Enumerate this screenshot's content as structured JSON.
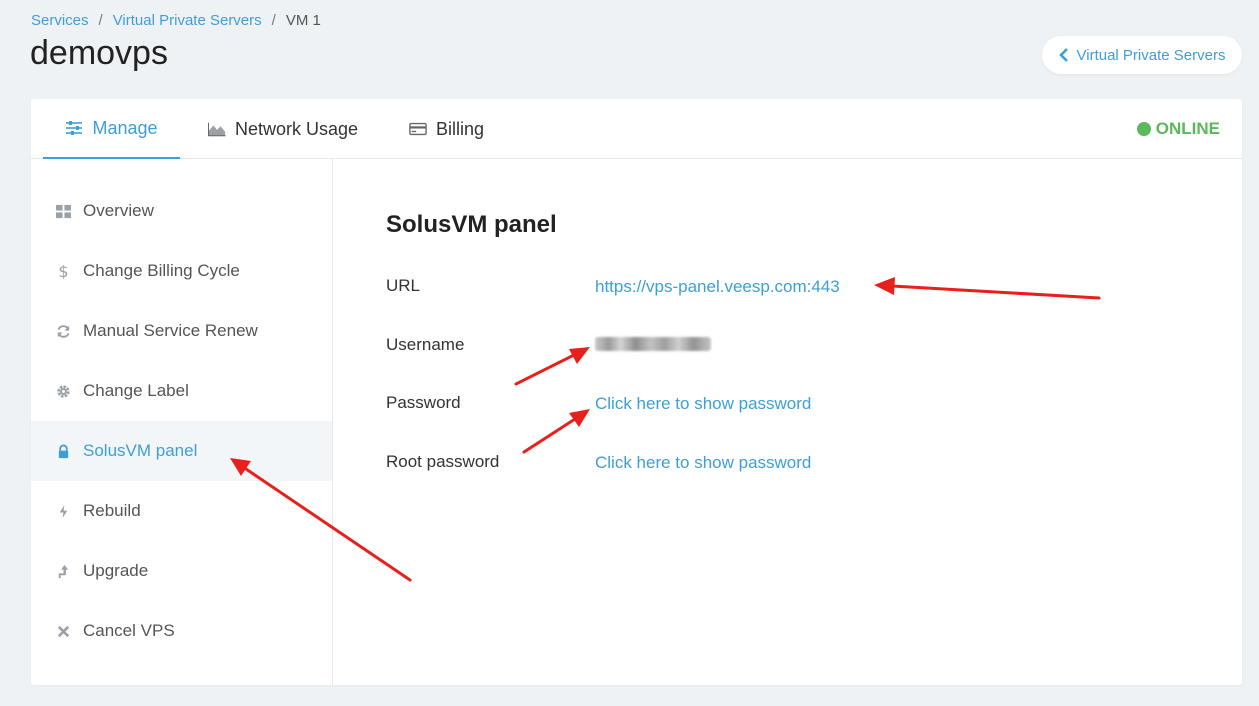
{
  "breadcrumb": {
    "item1": "Services",
    "sep1": "/",
    "item2": "Virtual Private Servers",
    "sep2": "/",
    "item3": "VM 1"
  },
  "page": {
    "title": "demovps"
  },
  "back_button": {
    "label": "Virtual Private Servers",
    "icon": "chevron-left-icon"
  },
  "tabs": [
    {
      "label": "Manage",
      "icon": "sliders-icon",
      "active": true
    },
    {
      "label": "Network Usage",
      "icon": "area-chart-icon",
      "active": false
    },
    {
      "label": "Billing",
      "icon": "credit-card-icon",
      "active": false
    }
  ],
  "status": {
    "label": "ONLINE",
    "color": "#5cb85c"
  },
  "sidebar": {
    "items": [
      {
        "label": "Overview",
        "icon": "grid-icon"
      },
      {
        "label": "Change Billing Cycle",
        "icon": "dollar-icon"
      },
      {
        "label": "Manual Service Renew",
        "icon": "refresh-icon"
      },
      {
        "label": "Change Label",
        "icon": "gear-icon"
      },
      {
        "label": "SolusVM panel",
        "icon": "lock-icon",
        "active": true
      },
      {
        "label": "Rebuild",
        "icon": "bolt-icon"
      },
      {
        "label": "Upgrade",
        "icon": "upgrade-arrow-icon"
      },
      {
        "label": "Cancel VPS",
        "icon": "close-icon"
      }
    ]
  },
  "panel": {
    "title": "SolusVM panel",
    "url_label": "URL",
    "url_value": "https://vps-panel.veesp.com:443",
    "username_label": "Username",
    "password_label": "Password",
    "password_link": "Click here to show password",
    "root_password_label": "Root password",
    "root_password_link": "Click here to show password"
  },
  "colors": {
    "accent": "#3c9fd9",
    "online": "#5cb85c",
    "annotation_arrow": "#e8201c",
    "background": "#eff2f4"
  }
}
